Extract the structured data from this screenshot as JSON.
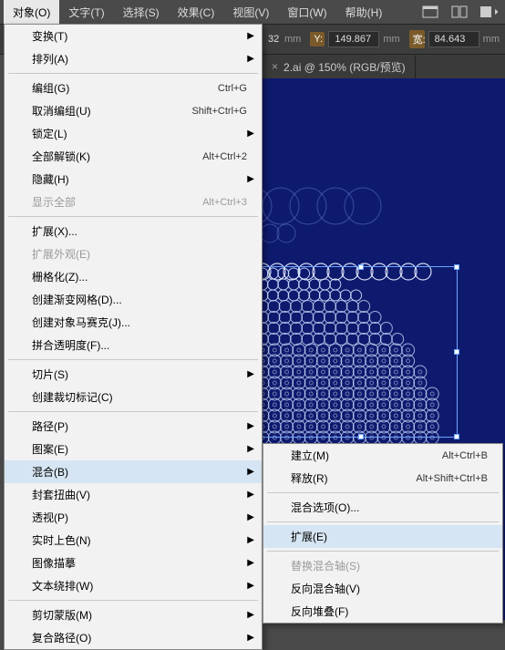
{
  "menubar": {
    "items": [
      {
        "label": "对象(O)",
        "active": true
      },
      {
        "label": "文字(T)"
      },
      {
        "label": "选择(S)"
      },
      {
        "label": "效果(C)"
      },
      {
        "label": "视图(V)"
      },
      {
        "label": "窗口(W)"
      },
      {
        "label": "帮助(H)"
      }
    ]
  },
  "toolbar": {
    "x_unit": "mm",
    "y_label": "Y:",
    "y_value": "149.867",
    "y_unit": "mm",
    "w_label": "宽:",
    "w_value": "84.643",
    "w_unit": "mm",
    "suffix": "32"
  },
  "tab": {
    "close": "×",
    "title": "2.ai @ 150% (RGB/预览)"
  },
  "menu1": {
    "groups": [
      [
        {
          "label": "变换(T)",
          "arrow": true
        },
        {
          "label": "排列(A)",
          "arrow": true
        }
      ],
      [
        {
          "label": "编组(G)",
          "sc": "Ctrl+G"
        },
        {
          "label": "取消编组(U)",
          "sc": "Shift+Ctrl+G"
        },
        {
          "label": "锁定(L)",
          "arrow": true
        },
        {
          "label": "全部解锁(K)",
          "sc": "Alt+Ctrl+2"
        },
        {
          "label": "隐藏(H)",
          "arrow": true
        },
        {
          "label": "显示全部",
          "sc": "Alt+Ctrl+3",
          "dis": true
        }
      ],
      [
        {
          "label": "扩展(X)..."
        },
        {
          "label": "扩展外观(E)",
          "dis": true
        },
        {
          "label": "栅格化(Z)..."
        },
        {
          "label": "创建渐变网格(D)..."
        },
        {
          "label": "创建对象马赛克(J)..."
        },
        {
          "label": "拼合透明度(F)..."
        }
      ],
      [
        {
          "label": "切片(S)",
          "arrow": true
        },
        {
          "label": "创建裁切标记(C)"
        }
      ],
      [
        {
          "label": "路径(P)",
          "arrow": true
        },
        {
          "label": "图案(E)",
          "arrow": true
        },
        {
          "label": "混合(B)",
          "arrow": true,
          "hov": true
        },
        {
          "label": "封套扭曲(V)",
          "arrow": true
        },
        {
          "label": "透视(P)",
          "arrow": true
        },
        {
          "label": "实时上色(N)",
          "arrow": true
        },
        {
          "label": "图像描摹",
          "arrow": true
        },
        {
          "label": "文本绕排(W)",
          "arrow": true
        }
      ],
      [
        {
          "label": "剪切蒙版(M)",
          "arrow": true
        },
        {
          "label": "复合路径(O)",
          "arrow": true
        }
      ]
    ]
  },
  "menu2": {
    "groups": [
      [
        {
          "label": "建立(M)",
          "sc": "Alt+Ctrl+B"
        },
        {
          "label": "释放(R)",
          "sc": "Alt+Shift+Ctrl+B"
        }
      ],
      [
        {
          "label": "混合选项(O)..."
        }
      ],
      [
        {
          "label": "扩展(E)",
          "hov": true
        }
      ],
      [
        {
          "label": "替换混合轴(S)",
          "dis": true
        },
        {
          "label": "反向混合轴(V)"
        },
        {
          "label": "反向堆叠(F)"
        }
      ]
    ]
  }
}
